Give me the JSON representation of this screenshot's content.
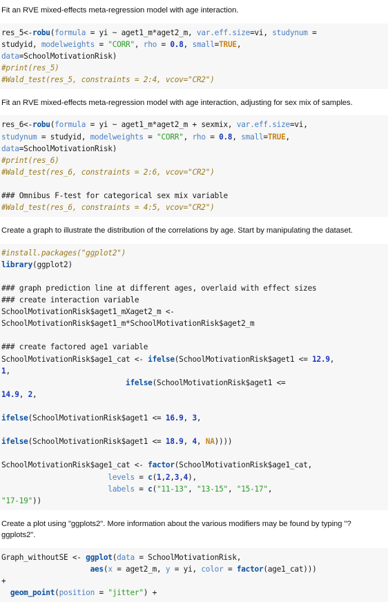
{
  "document": {
    "type": "r-markdown-notebook",
    "blocks": [
      {
        "kind": "prose",
        "id": "p1",
        "text": "Fit an RVE mixed-effects meta-regression model with age interaction."
      },
      {
        "kind": "code",
        "id": "c1",
        "lines": [
          "res_5<-robu(formula = yi ~ aget1_m*aget2_m, var.eff.size=vi, studynum =",
          "studyid, modelweights = \"CORR\", rho = 0.8, small=TRUE,",
          "data=SchoolMotivationRisk)",
          "#print(res_5)",
          "#Wald_test(res_5, constraints = 2:4, vcov=\"CR2\")"
        ]
      },
      {
        "kind": "prose",
        "id": "p2",
        "text": "Fit an RVE mixed-effects meta-regression model with age interaction, adjusting for sex mix of samples."
      },
      {
        "kind": "code",
        "id": "c2",
        "lines": [
          "res_6<-robu(formula = yi ~ aget1_m*aget2_m + sexmix, var.eff.size=vi,",
          "studynum = studyid, modelweights = \"CORR\", rho = 0.8, small=TRUE,",
          "data=SchoolMotivationRisk)",
          "#print(res_6)",
          "#Wald_test(res_6, constraints = 2:6, vcov=\"CR2\")",
          "",
          "### Omnibus F-test for categorical sex mix variable",
          "#Wald_test(res_6, constraints = 4:5, vcov=\"CR2\")"
        ]
      },
      {
        "kind": "prose",
        "id": "p3",
        "text": "Create a graph to illustrate the distribution of the correlations by age. Start by manipulating the dataset."
      },
      {
        "kind": "code",
        "id": "c3",
        "lines": [
          "#install.packages(\"ggplot2\")",
          "library(ggplot2)",
          "",
          "### graph prediction line at different ages, overlaid with effect sizes",
          "### create interaction variable",
          "SchoolMotivationRisk$aget1_mXaget2_m <-",
          "SchoolMotivationRisk$aget1_m*SchoolMotivationRisk$aget2_m",
          "",
          "### create factored age1 variable",
          "SchoolMotivationRisk$age1_cat <- ifelse(SchoolMotivationRisk$aget1 <= 12.9,",
          "1,",
          "                            ifelse(SchoolMotivationRisk$aget1 <=",
          "14.9, 2,",
          "",
          "ifelse(SchoolMotivationRisk$aget1 <= 16.9, 3,",
          "",
          "ifelse(SchoolMotivationRisk$aget1 <= 18.9, 4, NA))))",
          "",
          "SchoolMotivationRisk$age1_cat <- factor(SchoolMotivationRisk$age1_cat,",
          "                        levels = c(1,2,3,4),",
          "                        labels = c(\"11-13\", \"13-15\", \"15-17\",",
          "\"17-19\"))"
        ]
      },
      {
        "kind": "prose",
        "id": "p4",
        "text": "Create a plot using \"ggplots2\". More information about the various modifiers may be found by typing \"?ggplots2\"."
      },
      {
        "kind": "code",
        "id": "c4",
        "lines": [
          "Graph_withoutSE <- ggplot(data = SchoolMotivationRisk,",
          "                    aes(x = aget2_m, y = yi, color = factor(age1_cat)))",
          "+",
          "  geom_point(position = \"jitter\") +"
        ]
      }
    ]
  },
  "theme": {
    "code_background": "#f7f7f7",
    "page_background": "#ffffff",
    "text_color": "#111111",
    "token_function": "#0b50a0",
    "token_argument": "#4a7fc4",
    "token_string": "#2c9a26",
    "token_number": "#1a38b8",
    "token_constant": "#c78418",
    "token_comment": "#9a7a1e"
  }
}
